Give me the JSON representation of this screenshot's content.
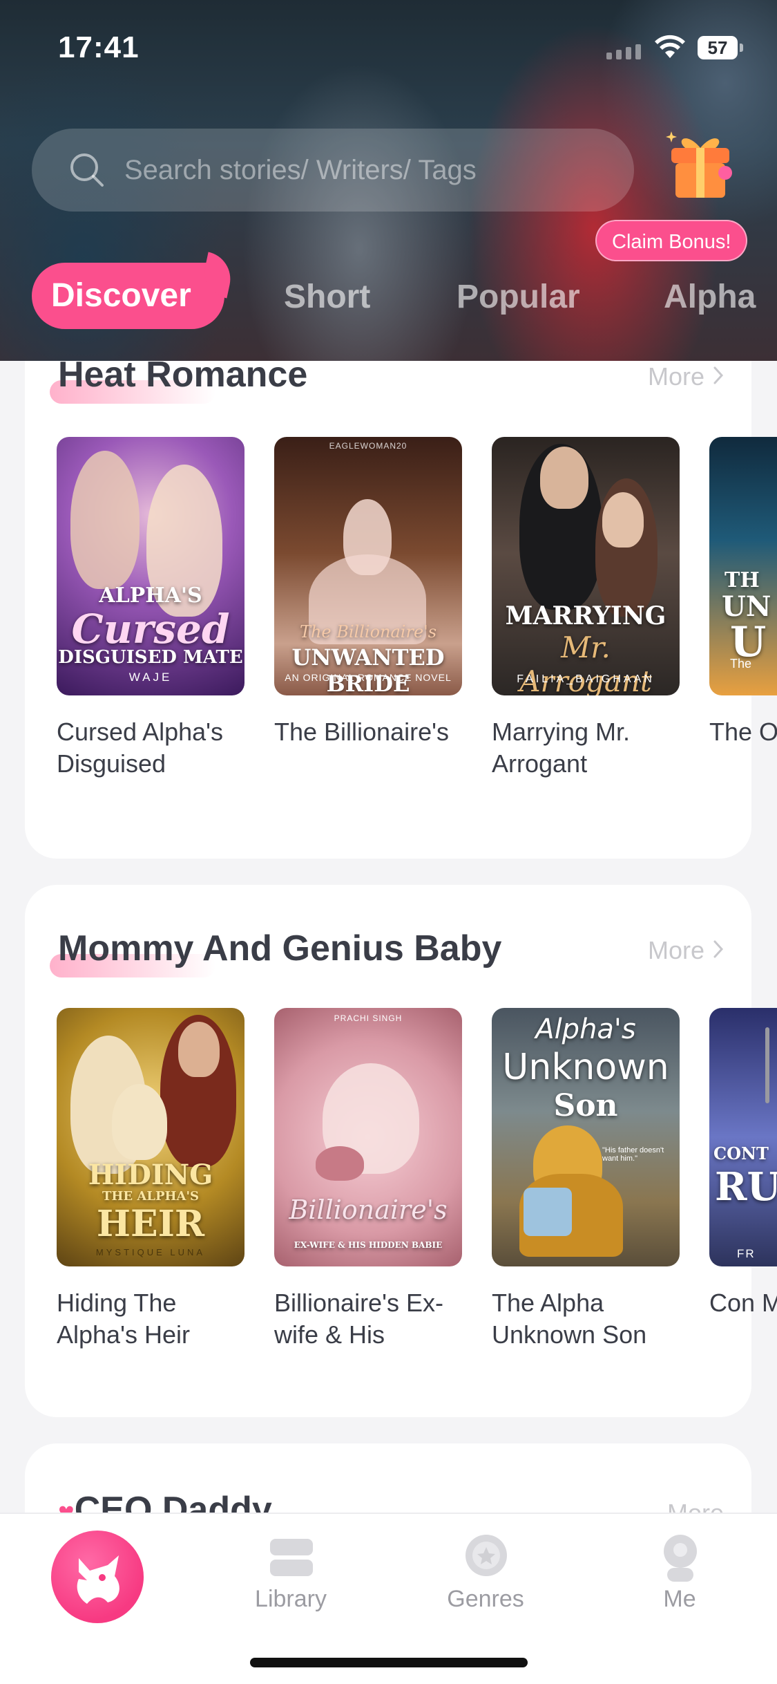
{
  "status_bar": {
    "time": "17:41",
    "battery": "57"
  },
  "search": {
    "placeholder": "Search stories/ Writers/ Tags"
  },
  "bonus": {
    "label": "Claim Bonus!"
  },
  "tabs": [
    {
      "label": "Discover",
      "active": true
    },
    {
      "label": "Short",
      "active": false
    },
    {
      "label": "Popular",
      "active": false
    },
    {
      "label": "Alpha",
      "active": false
    }
  ],
  "sections": [
    {
      "title": "Heat Romance",
      "more": "More",
      "books": [
        {
          "name": "Cursed Alpha's Disguised",
          "cover_title_1": "ALPHA'S",
          "cover_title_2": "Cursed",
          "cover_title_3": "DISGUISED MATE",
          "cover_author": "WAJE"
        },
        {
          "name": "The Billionaire's",
          "cover_top": "EAGLEWOMAN20",
          "cover_title_1": "The Billionaire's",
          "cover_title_2": "UNWANTED BRIDE",
          "cover_author": "AN ORIGINAL ROMANCE NOVEL"
        },
        {
          "name": "Marrying Mr. Arrogant",
          "cover_title_1": "MARRYING",
          "cover_title_2": "Mr. Arrogant",
          "cover_author": "FAILIA_BAIGHAAN"
        },
        {
          "name": "The Om",
          "cover_title_1": "TH",
          "cover_title_2": "UN",
          "cover_title_3": "U",
          "cover_author": "The"
        }
      ]
    },
    {
      "title": "Mommy And Genius Baby",
      "more": "More",
      "books": [
        {
          "name": "Hiding The Alpha's Heir",
          "cover_title_1": "HIDING",
          "cover_title_2": "THE ALPHA'S",
          "cover_title_3": "HEIR",
          "cover_author": "MYSTIQUE LUNA"
        },
        {
          "name": "Billionaire's Ex-wife & His",
          "cover_top": "PRACHI SINGH",
          "cover_title_1": "Billionaire's",
          "cover_title_2": "EX-WIFE & HIS HIDDEN BABIE",
          "cover_author": ""
        },
        {
          "name": "The Alpha Unknown Son",
          "cover_title_1": "Alpha's",
          "cover_title_2": "Unknown",
          "cover_title_3": "Son",
          "cover_author": "\"His father doesn't want him.\""
        },
        {
          "name": "Con Mar",
          "cover_title_1": "CONT",
          "cover_title_2": "RU",
          "cover_author": "FR"
        }
      ]
    },
    {
      "title": "CEO Daddy",
      "more": "More"
    }
  ],
  "tabbar": [
    {
      "label": ""
    },
    {
      "label": "Library"
    },
    {
      "label": "Genres"
    },
    {
      "label": "Me"
    }
  ],
  "colors": {
    "accent": "#fb4f8d",
    "text": "#3a3d47",
    "muted": "#9c9ca2"
  }
}
